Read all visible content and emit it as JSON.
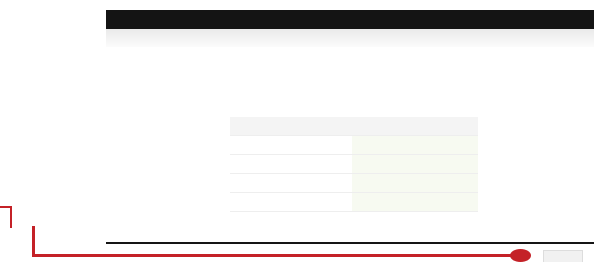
{
  "window": {
    "brand": "",
    "brand_suffix": "",
    "top_link": ""
  },
  "page": {
    "heading": "",
    "intro_line_1": "",
    "intro_line_2": ""
  },
  "info_table": {
    "header": {
      "label": "",
      "value": ""
    },
    "rows": [
      {
        "label": "",
        "value": ""
      },
      {
        "label": "",
        "value": ""
      },
      {
        "label": "",
        "value": ""
      },
      {
        "label": "",
        "value": ""
      }
    ]
  },
  "footer": {
    "text": "",
    "button_label": ""
  },
  "colors": {
    "top_bar": "#141414",
    "callout": "#c42127",
    "value_cell": "#f7faf1",
    "page_background": "#ffffff"
  }
}
